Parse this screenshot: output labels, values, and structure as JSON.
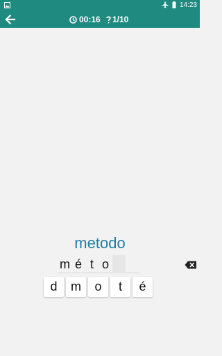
{
  "status_bar": {
    "time": "14:23",
    "icons": [
      "image-icon",
      "airplane-icon",
      "battery-icon"
    ]
  },
  "app_bar": {
    "back_icon": "arrow-left-icon",
    "timer_icon": "clock-icon",
    "timer": "00:16",
    "progress_icon": "question-icon",
    "progress": "1/10"
  },
  "exercise": {
    "prompt_word": "metodo",
    "answer_slots": [
      "m",
      "é",
      "t",
      "o",
      "",
      ""
    ],
    "delete_icon": "backspace-icon",
    "letter_tiles": [
      "d",
      "m",
      "o",
      "t",
      "é"
    ]
  },
  "colors": {
    "primary": "#1f8a80",
    "prompt_text": "#1f7ea3",
    "background": "#f2f2f2"
  }
}
